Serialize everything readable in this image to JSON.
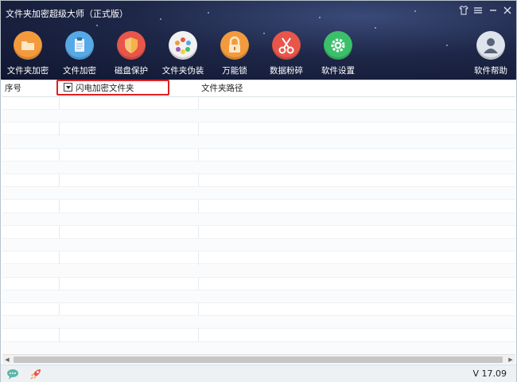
{
  "app": {
    "title": "文件夹加密超级大师（正式版）"
  },
  "window_controls": [
    {
      "name": "skin-icon",
      "glyph": "⛉"
    },
    {
      "name": "menu-icon",
      "glyph": "☰"
    },
    {
      "name": "minimize-icon",
      "glyph": "—"
    },
    {
      "name": "close-icon",
      "glyph": "✕"
    }
  ],
  "toolbar": {
    "items": [
      {
        "name": "folder-encrypt",
        "label": "文件夹加密",
        "icon": "folder-icon",
        "color": "#f39b3c"
      },
      {
        "name": "file-encrypt",
        "label": "文件加密",
        "icon": "document-icon",
        "color": "#56a9e6"
      },
      {
        "name": "disk-protect",
        "label": "磁盘保护",
        "icon": "shield-icon",
        "color": "#e8564a"
      },
      {
        "name": "folder-disguise",
        "label": "文件夹伪装",
        "icon": "palette-icon",
        "color": "#f2f2f2"
      },
      {
        "name": "master-lock",
        "label": "万能锁",
        "icon": "lock-icon",
        "color": "#f39b3c"
      },
      {
        "name": "data-shred",
        "label": "数据粉碎",
        "icon": "scissors-icon",
        "color": "#e8564a"
      },
      {
        "name": "software-settings",
        "label": "软件设置",
        "icon": "gear-icon",
        "color": "#3cbf6a"
      }
    ],
    "help": {
      "label": "软件帮助",
      "icon": "user-icon",
      "color": "#dfe4ec"
    }
  },
  "table": {
    "columns": [
      "序号",
      "闪电加密文件夹",
      "文件夹路径"
    ],
    "rows": []
  },
  "status": {
    "version": "V 17.09"
  },
  "colors": {
    "highlight": "#e02020",
    "header_bg": "#1e2748"
  }
}
